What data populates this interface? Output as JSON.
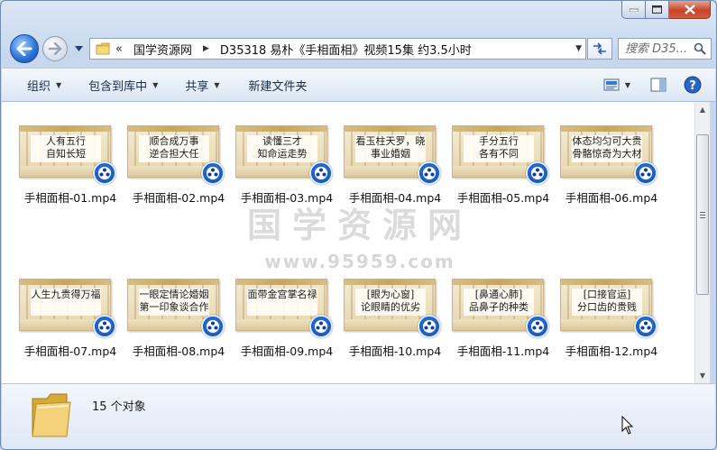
{
  "window": {
    "address": {
      "chevron": "«",
      "crumbs": [
        "国学资源网",
        "D35318 易朴《手相面相》视频15集 约3.5小时"
      ]
    },
    "search": {
      "placeholder": "搜索 D35..."
    }
  },
  "toolbar": {
    "organize": "组织",
    "include_library": "包含到库中",
    "share": "共享",
    "new_folder": "新建文件夹"
  },
  "files": [
    {
      "name": "手相面相-01.mp4",
      "thumb_text": "人有五行\n自知长短"
    },
    {
      "name": "手相面相-02.mp4",
      "thumb_text": "顺合成万事\n逆合担大任"
    },
    {
      "name": "手相面相-03.mp4",
      "thumb_text": "读懂三才\n知命运走势"
    },
    {
      "name": "手相面相-04.mp4",
      "thumb_text": "看玉柱天罗，晓\n事业婚姻"
    },
    {
      "name": "手相面相-05.mp4",
      "thumb_text": "手分五行\n各有不同"
    },
    {
      "name": "手相面相-06.mp4",
      "thumb_text": "体态均匀可大贵\n骨骼惊奇为大材"
    },
    {
      "name": "手相面相-07.mp4",
      "thumb_text": "人生九贵得万福"
    },
    {
      "name": "手相面相-08.mp4",
      "thumb_text": "一眼定情论婚姻\n第一印象谈合作"
    },
    {
      "name": "手相面相-09.mp4",
      "thumb_text": "面带金宫掌名禄"
    },
    {
      "name": "手相面相-10.mp4",
      "thumb_text": "[眼为心窗]\n论眼睛的优劣"
    },
    {
      "name": "手相面相-11.mp4",
      "thumb_text": "[鼻通心肺]\n品鼻子的种类"
    },
    {
      "name": "手相面相-12.mp4",
      "thumb_text": "[口接官运]\n分口齿的贵贱"
    }
  ],
  "watermark": {
    "text": "国学资源网",
    "url": "www.95959.com"
  },
  "status": {
    "count_text": "15 个对象"
  }
}
